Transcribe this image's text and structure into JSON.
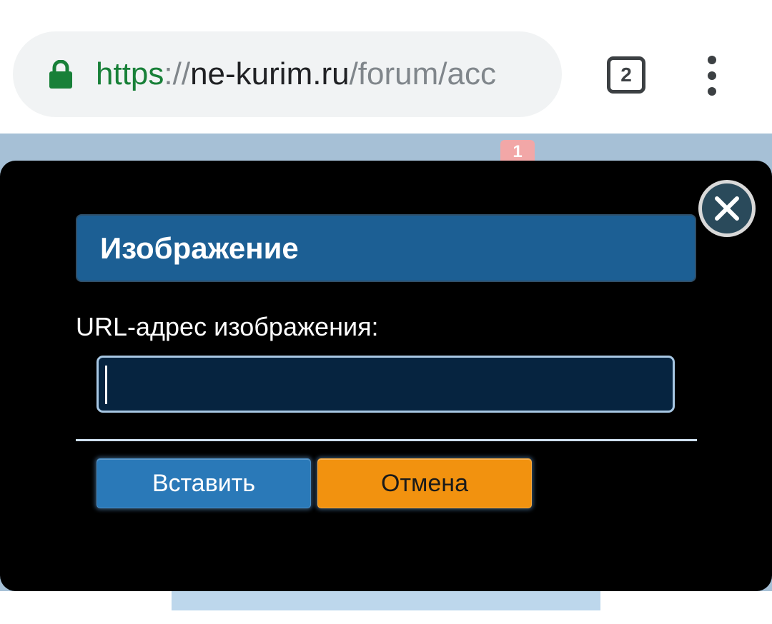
{
  "browser": {
    "url": {
      "scheme": "https",
      "separator": "://",
      "host": "ne-kurim.ru",
      "path": "/forum/acc"
    },
    "tab_count": "2",
    "icons": {
      "lock": "lock-icon",
      "menu": "more-vert-icon"
    },
    "colors": {
      "secure": "#188038",
      "url_bar_bg": "#f1f3f4"
    }
  },
  "page": {
    "notification_count": "1"
  },
  "dialog": {
    "title": "Изображение",
    "field_label": "URL-адрес изображения:",
    "url_value": "",
    "buttons": {
      "insert": "Вставить",
      "cancel": "Отмена"
    },
    "icons": {
      "close": "close-icon"
    },
    "colors": {
      "title_bar": "#1c5f94",
      "input_bg": "#062440",
      "insert_button": "#2a79b8",
      "cancel_button": "#f2920f"
    }
  }
}
